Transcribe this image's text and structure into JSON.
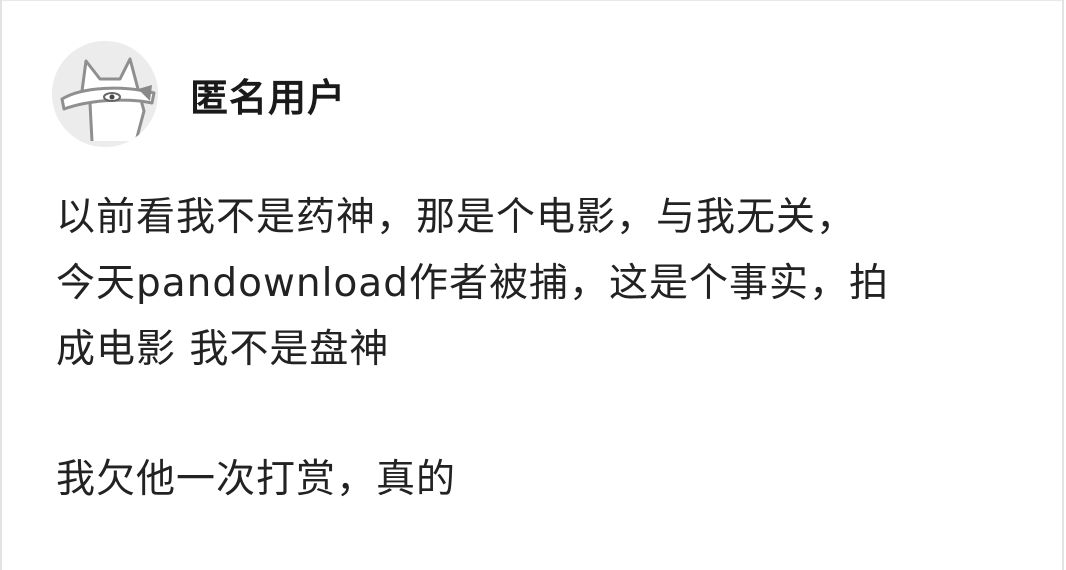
{
  "post": {
    "author": {
      "name": "匿名用户",
      "avatar_icon": "anonymous-masked-cat-icon"
    },
    "paragraphs": [
      {
        "lines": [
          "以前看我不是药神，那是个电影，与我无关，",
          "今天pandownload作者被捕，这是个事实，拍",
          "成电影 我不是盘神"
        ]
      },
      {
        "lines": [
          "我欠他一次打赏，真的"
        ]
      }
    ]
  },
  "colors": {
    "text": "#222222",
    "avatar_bg": "#ececec",
    "avatar_line": "#9a9a9a"
  }
}
